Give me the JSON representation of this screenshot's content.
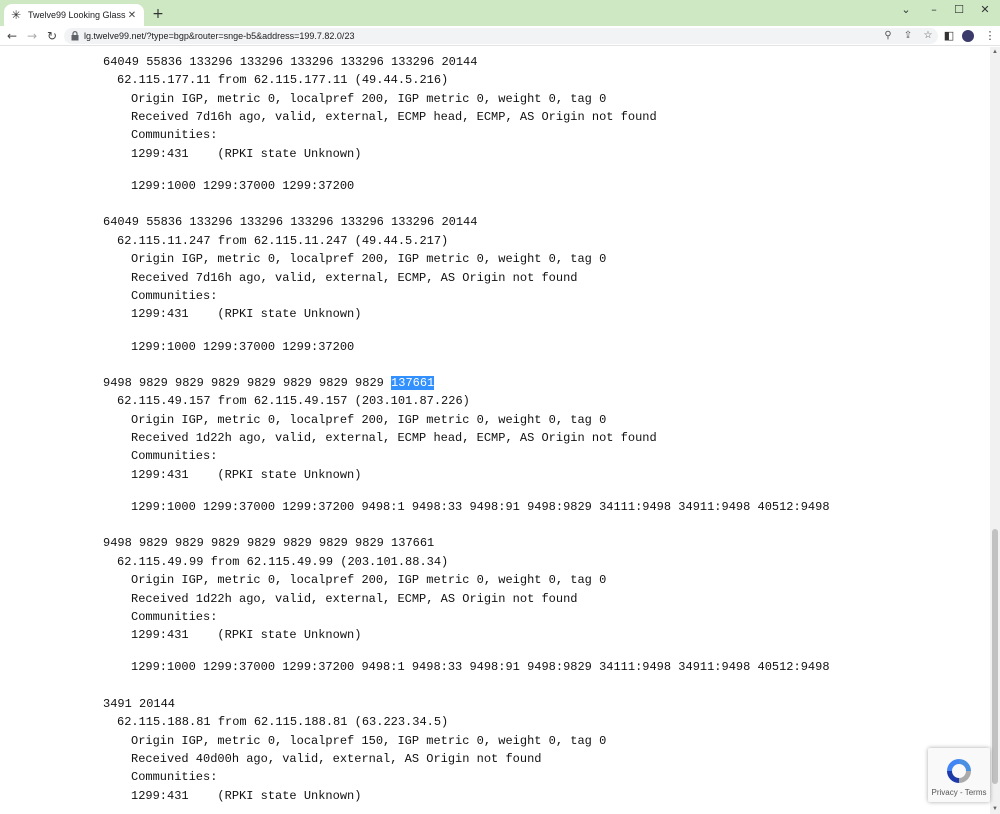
{
  "browser": {
    "tab_title": "Twelve99 Looking Glass",
    "url": "lg.twelve99.net/?type=bgp&router=snge-b5&address=199.7.82.0/23",
    "accent_color": "#cde8c3"
  },
  "routes": [
    {
      "as_path": "64049 55836 133296 133296 133296 133296 133296 20144",
      "nexthop": "62.115.177.11 from 62.115.177.11 (49.44.5.216)",
      "origin": "Origin IGP, metric 0, localpref 200, IGP metric 0, weight 0, tag 0",
      "received": "Received 7d16h ago, valid, external, ECMP head, ECMP, AS Origin not found",
      "communities_label": "Communities:",
      "community_rpki": "1299:431    (RPKI state Unknown)",
      "community_list": "1299:1000 1299:37000 1299:37200"
    },
    {
      "as_path": "64049 55836 133296 133296 133296 133296 133296 20144",
      "nexthop": "62.115.11.247 from 62.115.11.247 (49.44.5.217)",
      "origin": "Origin IGP, metric 0, localpref 200, IGP metric 0, weight 0, tag 0",
      "received": "Received 7d16h ago, valid, external, ECMP, AS Origin not found",
      "communities_label": "Communities:",
      "community_rpki": "1299:431    (RPKI state Unknown)",
      "community_list": "1299:1000 1299:37000 1299:37200"
    },
    {
      "as_path_prefix": "9498 9829 9829 9829 9829 9829 9829 9829 ",
      "as_path_highlight": "137661",
      "nexthop": "62.115.49.157 from 62.115.49.157 (203.101.87.226)",
      "origin": "Origin IGP, metric 0, localpref 200, IGP metric 0, weight 0, tag 0",
      "received": "Received 1d22h ago, valid, external, ECMP head, ECMP, AS Origin not found",
      "communities_label": "Communities:",
      "community_rpki": "1299:431    (RPKI state Unknown)",
      "community_list": "1299:1000 1299:37000 1299:37200 9498:1 9498:33 9498:91 9498:9829 34111:9498 34911:9498 40512:9498"
    },
    {
      "as_path": "9498 9829 9829 9829 9829 9829 9829 9829 137661",
      "nexthop": "62.115.49.99 from 62.115.49.99 (203.101.88.34)",
      "origin": "Origin IGP, metric 0, localpref 200, IGP metric 0, weight 0, tag 0",
      "received": "Received 1d22h ago, valid, external, ECMP, AS Origin not found",
      "communities_label": "Communities:",
      "community_rpki": "1299:431    (RPKI state Unknown)",
      "community_list": "1299:1000 1299:37000 1299:37200 9498:1 9498:33 9498:91 9498:9829 34111:9498 34911:9498 40512:9498"
    },
    {
      "as_path": "3491 20144",
      "nexthop": "62.115.188.81 from 62.115.188.81 (63.223.34.5)",
      "origin": "Origin IGP, metric 0, localpref 150, IGP metric 0, weight 0, tag 0",
      "received": "Received 40d00h ago, valid, external, AS Origin not found",
      "communities_label": "Communities:",
      "community_rpki": "1299:431    (RPKI state Unknown)"
    }
  ],
  "recaptcha": {
    "links": "Privacy - Terms"
  }
}
